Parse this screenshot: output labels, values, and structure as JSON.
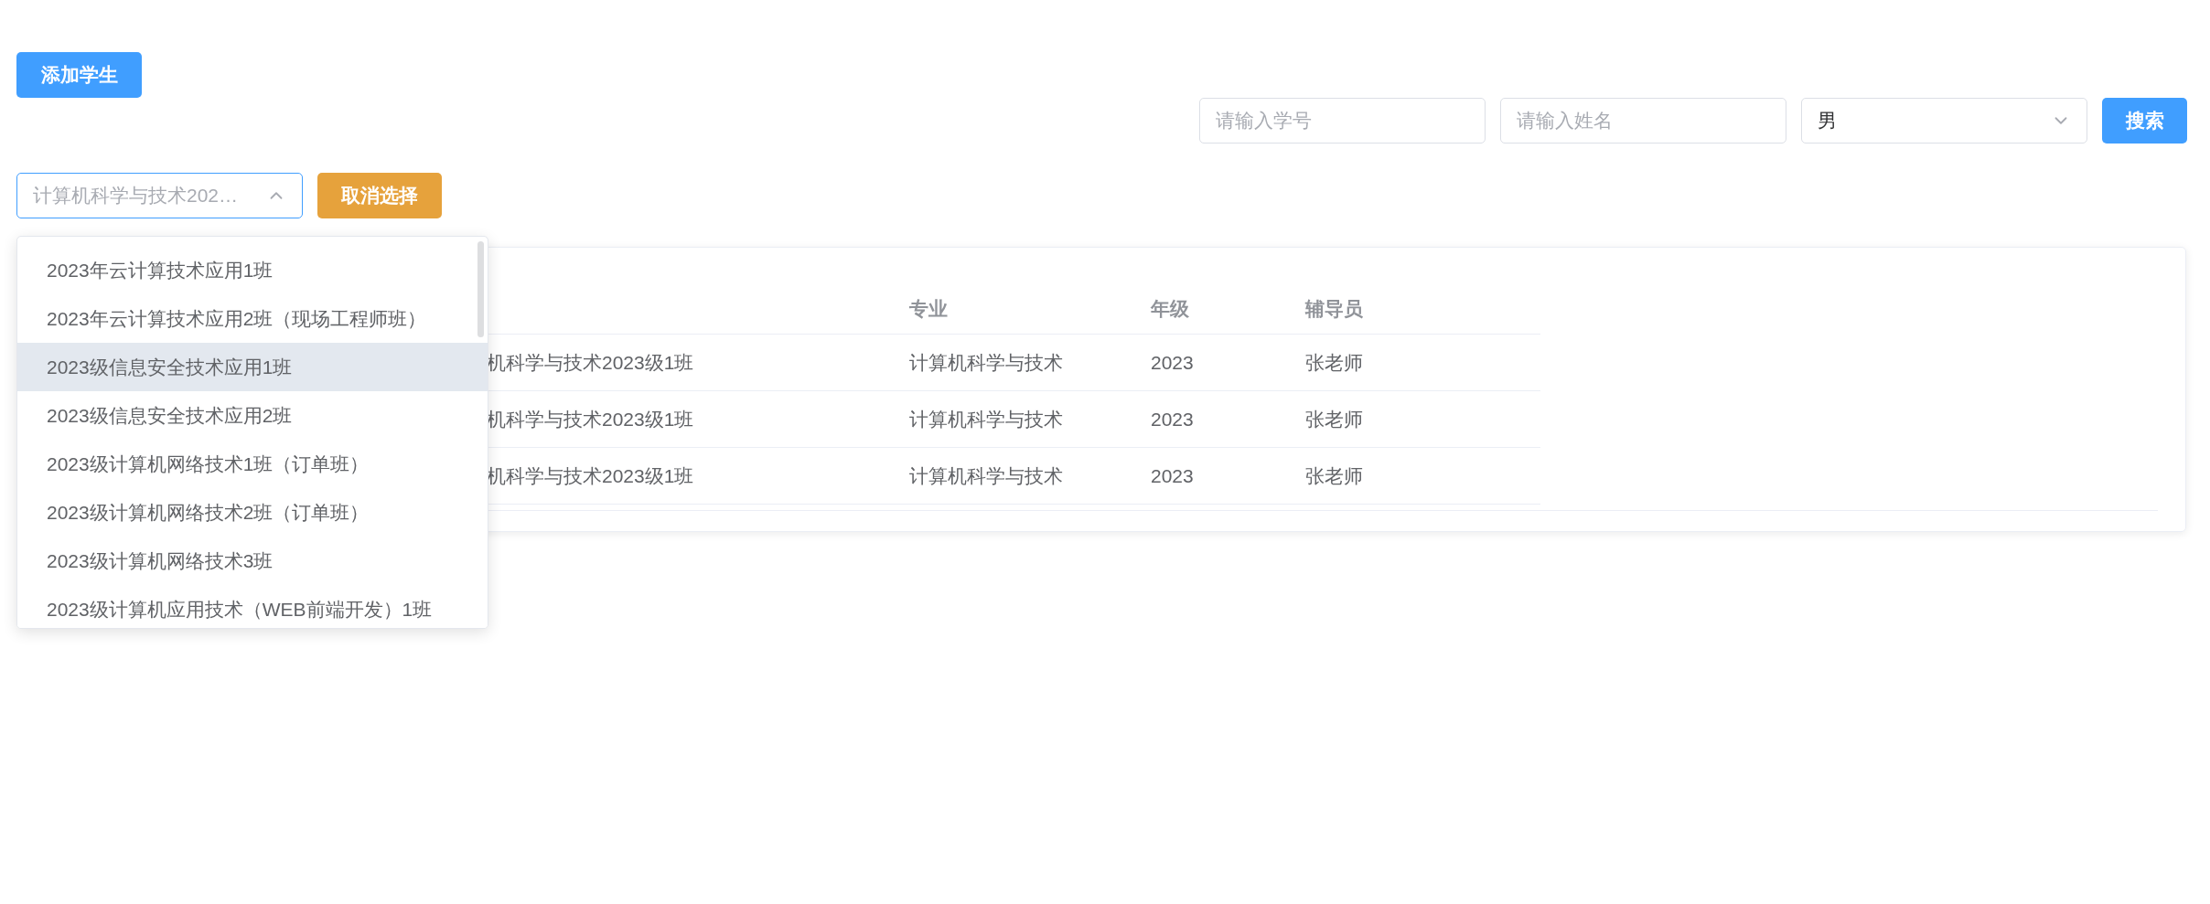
{
  "add_button": "添加学生",
  "search": {
    "student_id": {
      "placeholder": "请输入学号"
    },
    "name": {
      "placeholder": "请输入姓名"
    },
    "gender": {
      "value": "男"
    },
    "button": "搜索"
  },
  "class_select": {
    "placeholder": "计算机科学与技术202…",
    "expanded": true
  },
  "cancel_button": "取消选择",
  "dropdown": {
    "options": [
      {
        "label": "2023年云计算技术应用1班",
        "selected": false
      },
      {
        "label": "2023年云计算技术应用2班（现场工程师班）",
        "selected": false
      },
      {
        "label": "2023级信息安全技术应用1班",
        "selected": true
      },
      {
        "label": "2023级信息安全技术应用2班",
        "selected": false
      },
      {
        "label": "2023级计算机网络技术1班（订单班）",
        "selected": false
      },
      {
        "label": "2023级计算机网络技术2班（订单班）",
        "selected": false
      },
      {
        "label": "2023级计算机网络技术3班",
        "selected": false
      },
      {
        "label": "2023级计算机应用技术（WEB前端开发）1班",
        "selected": false
      }
    ]
  },
  "table": {
    "columns": [
      "",
      "专业",
      "年级",
      "辅导员"
    ],
    "rows": [
      [
        "机科学与技术2023级1班",
        "计算机科学与技术",
        "2023",
        "张老师"
      ],
      [
        "机科学与技术2023级1班",
        "计算机科学与技术",
        "2023",
        "张老师"
      ],
      [
        "机科学与技术2023级1班",
        "计算机科学与技术",
        "2023",
        "张老师"
      ]
    ]
  }
}
